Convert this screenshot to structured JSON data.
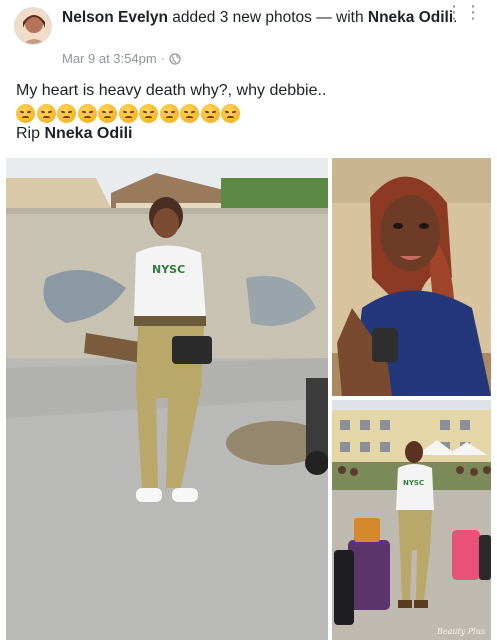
{
  "post": {
    "author": "Nelson Evelyn",
    "action": "added 3 new photos — with",
    "tagged": "Nneka Odili",
    "tagged_suffix": ".",
    "timestamp": "Mar 9 at 3:54pm",
    "separator": "·",
    "privacy_icon": "globe-icon",
    "more_icon": "more-options-icon",
    "more_glyph": "⋮⋮"
  },
  "body": {
    "line1": "My heart is heavy death why?, why debbie..",
    "emoji_count": 11,
    "emoji_icon": "unamused-face-emoji",
    "rip_prefix": "Rip ",
    "rip_name": "Nneka Odili"
  },
  "photos": {
    "count": 3,
    "watermark": "Beauty Plus"
  },
  "colors": {
    "text": "#1d2129",
    "meta": "#90949c",
    "uniform_khaki": "#b9a86a",
    "emoji": "#f7b52a"
  }
}
